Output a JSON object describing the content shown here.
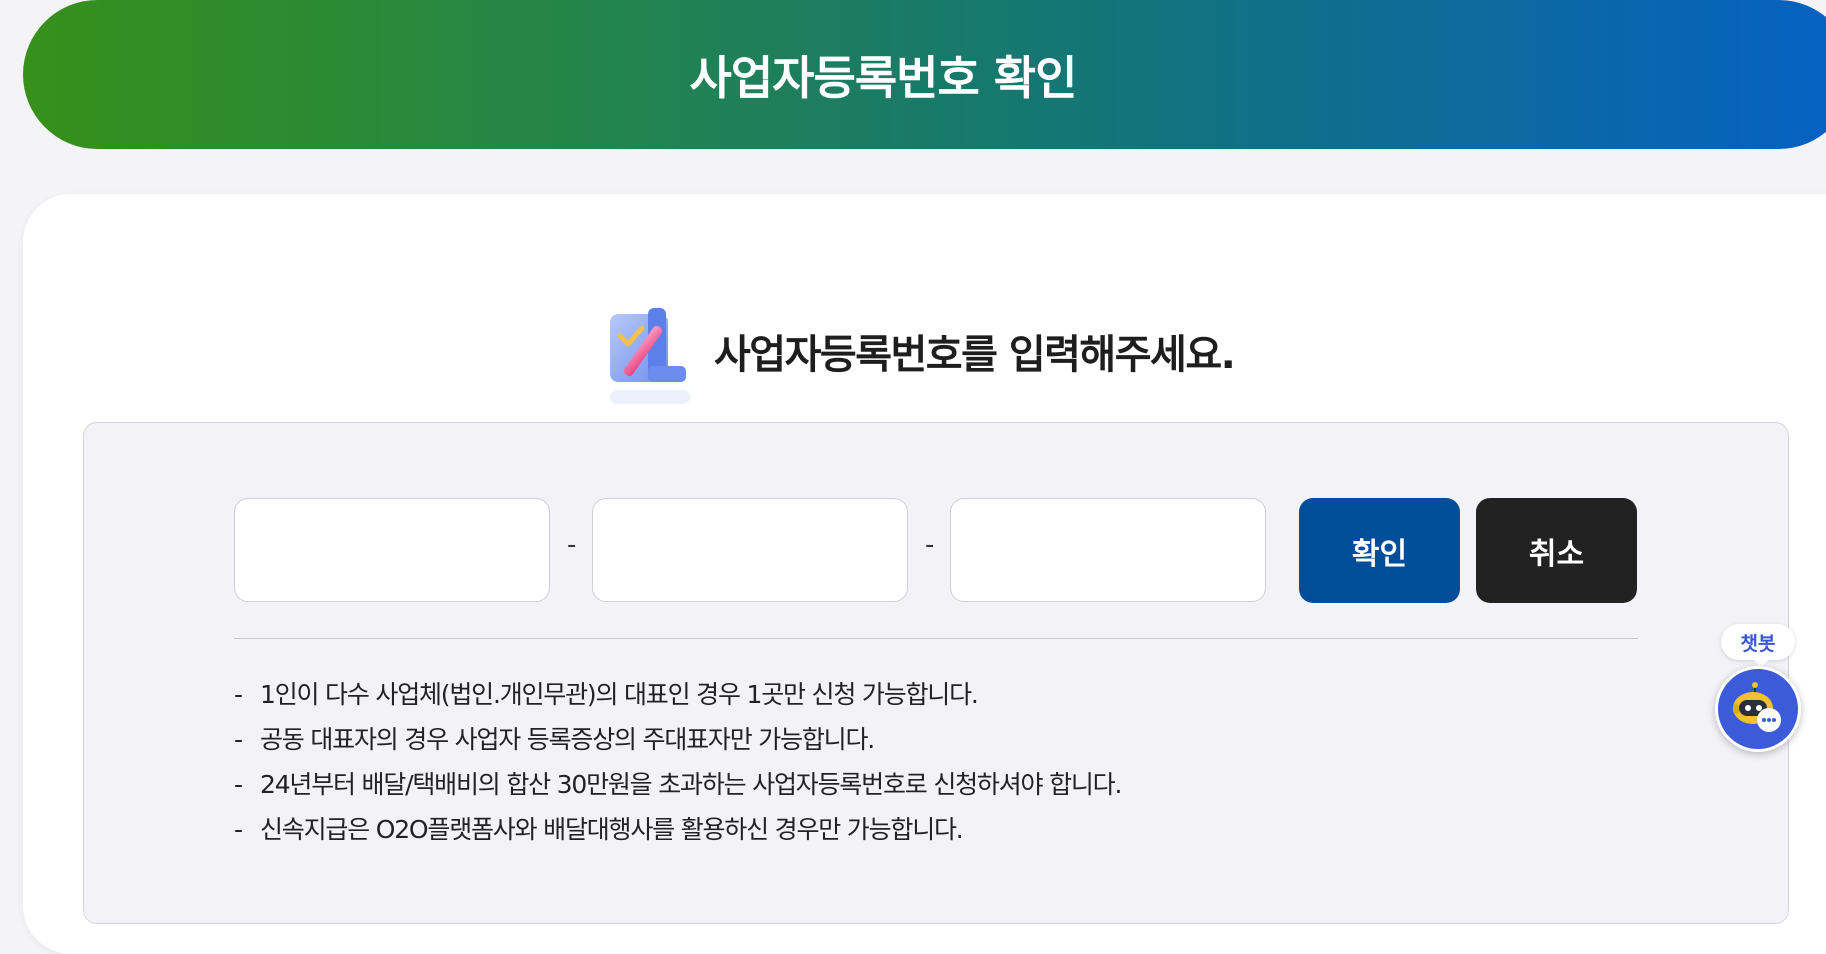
{
  "header": {
    "title": "사업자등록번호 확인"
  },
  "prompt": {
    "icon": "edit-document-icon",
    "title": "사업자등록번호를 입력해주세요."
  },
  "form": {
    "field1": {
      "value": "",
      "placeholder": ""
    },
    "field2": {
      "value": "",
      "placeholder": ""
    },
    "field3": {
      "value": "",
      "placeholder": ""
    },
    "separator": "-",
    "confirm_label": "확인",
    "cancel_label": "취소"
  },
  "notes": [
    {
      "bullet": "-",
      "text": "1인이 다수 사업체(법인.개인무관)의 대표인 경우 1곳만 신청 가능합니다."
    },
    {
      "bullet": "-",
      "text": "공동 대표자의 경우 사업자 등록증상의 주대표자만 가능합니다."
    },
    {
      "bullet": "-",
      "text": "24년부터 배달/택배비의 합산 30만원을 초과하는 사업자등록번호로 신청하셔야 합니다."
    },
    {
      "bullet": "-",
      "text": "신속지급은 O2O플랫폼사와 배달대행사를 활용하신 경우만 가능합니다."
    }
  ],
  "chatbot": {
    "label": "챗봇",
    "icon": "chatbot-robot-icon"
  },
  "colors": {
    "header_gradient_start": "#36901a",
    "header_gradient_end": "#0660c4",
    "confirm_button": "#004d99",
    "cancel_button": "#222222",
    "chatbot": "#3b5bdb"
  }
}
